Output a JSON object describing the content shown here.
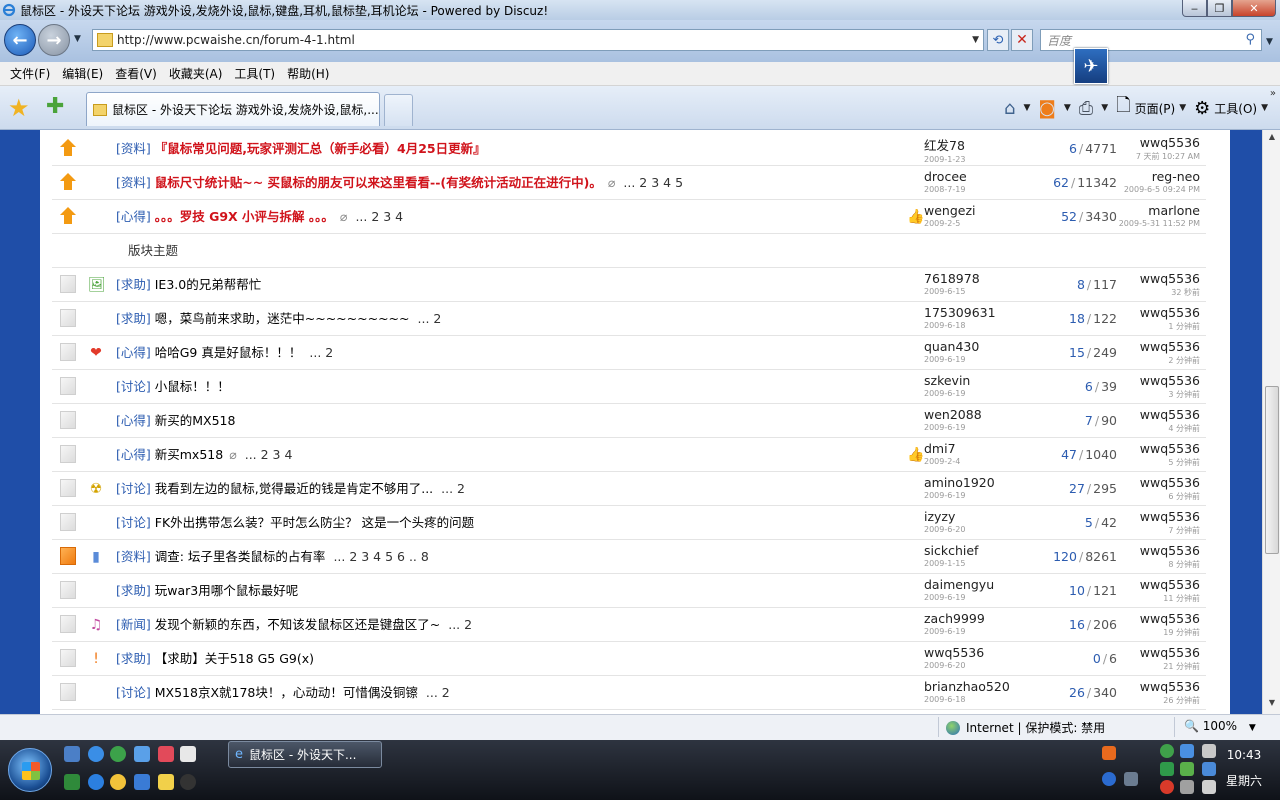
{
  "window": {
    "title": "鼠标区 - 外设天下论坛 游戏外设,发烧外设,鼠标,键盘,耳机,鼠标垫,耳机论坛 - Powered by Discuz!",
    "minimize": "‒",
    "maximize": "❐",
    "close": "✕"
  },
  "address": {
    "url": "http://www.pcwaishe.cn/forum-4-1.html",
    "search_placeholder": "百度"
  },
  "menu": [
    "文件(F)",
    "编辑(E)",
    "查看(V)",
    "收藏夹(A)",
    "工具(T)",
    "帮助(H)"
  ],
  "tab": {
    "title": "鼠标区 - 外设天下论坛 游戏外设,发烧外设,鼠标,..."
  },
  "commands": {
    "page": "页面(P)",
    "tools": "工具(O)"
  },
  "forum": {
    "section_label": "版块主题",
    "threads": [
      {
        "folder": "up",
        "cat": "[资料]",
        "title": "『鼠标常见问题,玩家评测汇总（新手必看）4月25日更新』",
        "red": true,
        "clip": false,
        "pages": "",
        "icon": "",
        "thumb": false,
        "author": "红发78",
        "date": "2009-1-23",
        "replies": "6",
        "views": "4771",
        "last_user": "wwq5536",
        "last_time": "7 天前 10:27 AM"
      },
      {
        "folder": "up",
        "cat": "[资料]",
        "title": "鼠标尺寸统计贴~~ 买鼠标的朋友可以来这里看看--(有奖统计活动正在进行中)。",
        "red": true,
        "clip": true,
        "pages": "... 2 3 4 5",
        "icon": "",
        "thumb": false,
        "author": "drocee",
        "date": "2008-7-19",
        "replies": "62",
        "views": "11342",
        "last_user": "reg-neo",
        "last_time": "2009-6-5 09:24 PM"
      },
      {
        "folder": "up",
        "cat": "[心得]",
        "title": "。。。罗技 G9X 小评与拆解 。。。",
        "red": true,
        "clip": true,
        "pages": "... 2 3 4",
        "icon": "",
        "thumb": true,
        "author": "wengezi",
        "date": "2009-2-5",
        "replies": "52",
        "views": "3430",
        "last_user": "marlone",
        "last_time": "2009-5-31 11:52 PM"
      },
      {
        "section": true
      },
      {
        "folder": "doc",
        "cat": "[求助]",
        "title": "IE3.0的兄弟帮帮忙",
        "red": false,
        "clip": false,
        "pages": "",
        "icon": "img",
        "thumb": false,
        "author": "7618978",
        "date": "2009-6-15",
        "replies": "8",
        "views": "117",
        "last_user": "wwq5536",
        "last_time": "32 秒前"
      },
      {
        "folder": "doc",
        "cat": "[求助]",
        "title": "嗯，菜鸟前来求助，迷茫中~~~~~~~~~~",
        "red": false,
        "clip": false,
        "pages": "... 2",
        "icon": "",
        "thumb": false,
        "author": "175309631",
        "date": "2009-6-18",
        "replies": "18",
        "views": "122",
        "last_user": "wwq5536",
        "last_time": "1 分钟前"
      },
      {
        "folder": "doc",
        "cat": "[心得]",
        "title": "哈哈G9 真是好鼠标！！！",
        "red": false,
        "clip": false,
        "pages": "... 2",
        "icon": "heart",
        "thumb": false,
        "author": "quan430",
        "date": "2009-6-19",
        "replies": "15",
        "views": "249",
        "last_user": "wwq5536",
        "last_time": "2 分钟前"
      },
      {
        "folder": "doc",
        "cat": "[讨论]",
        "title": "小鼠标！！！",
        "red": false,
        "clip": false,
        "pages": "",
        "icon": "",
        "thumb": false,
        "author": "szkevin",
        "date": "2009-6-19",
        "replies": "6",
        "views": "39",
        "last_user": "wwq5536",
        "last_time": "3 分钟前"
      },
      {
        "folder": "doc",
        "cat": "[心得]",
        "title": "新买的MX518",
        "red": false,
        "clip": false,
        "pages": "",
        "icon": "",
        "thumb": false,
        "author": "wen2088",
        "date": "2009-6-19",
        "replies": "7",
        "views": "90",
        "last_user": "wwq5536",
        "last_time": "4 分钟前"
      },
      {
        "folder": "doc",
        "cat": "[心得]",
        "title": "新买mx518",
        "red": false,
        "clip": true,
        "pages": "... 2 3 4",
        "icon": "",
        "thumb": true,
        "author": "dmi7",
        "date": "2009-2-4",
        "replies": "47",
        "views": "1040",
        "last_user": "wwq5536",
        "last_time": "5 分钟前"
      },
      {
        "folder": "doc",
        "cat": "[讨论]",
        "title": "我看到左边的鼠标,觉得最近的钱是肯定不够用了...",
        "red": false,
        "clip": false,
        "pages": "... 2",
        "icon": "radiation",
        "thumb": false,
        "author": "amino1920",
        "date": "2009-6-19",
        "replies": "27",
        "views": "295",
        "last_user": "wwq5536",
        "last_time": "6 分钟前"
      },
      {
        "folder": "doc",
        "cat": "[讨论]",
        "title": "FK外出携带怎么装？平时怎么防尘？ 这是一个头疼的问题",
        "red": false,
        "clip": false,
        "pages": "",
        "icon": "",
        "thumb": false,
        "author": "izyzy",
        "date": "2009-6-20",
        "replies": "5",
        "views": "42",
        "last_user": "wwq5536",
        "last_time": "7 分钟前"
      },
      {
        "folder": "hot",
        "cat": "[资料]",
        "title": "调查: 坛子里各类鼠标的占有率",
        "red": false,
        "clip": false,
        "pages": "... 2 3 4 5 6 .. 8",
        "icon": "chart",
        "thumb": false,
        "author": "sickchief",
        "date": "2009-1-15",
        "replies": "120",
        "views": "8261",
        "last_user": "wwq5536",
        "last_time": "8 分钟前"
      },
      {
        "folder": "doc",
        "cat": "[求助]",
        "title": "玩war3用哪个鼠标最好呢",
        "red": false,
        "clip": false,
        "pages": "",
        "icon": "",
        "thumb": false,
        "author": "daimengyu",
        "date": "2009-6-19",
        "replies": "10",
        "views": "121",
        "last_user": "wwq5536",
        "last_time": "11 分钟前"
      },
      {
        "folder": "doc",
        "cat": "[新闻]",
        "title": "发现个新颖的东西，不知该发鼠标区还是键盘区了~",
        "red": false,
        "clip": false,
        "pages": "... 2",
        "icon": "music",
        "thumb": false,
        "author": "zach9999",
        "date": "2009-6-19",
        "replies": "16",
        "views": "206",
        "last_user": "wwq5536",
        "last_time": "19 分钟前"
      },
      {
        "folder": "doc",
        "cat": "[求助]",
        "title": "【求助】关于518 G5 G9(x)",
        "red": false,
        "clip": false,
        "pages": "",
        "icon": "alert",
        "thumb": false,
        "author": "wwq5536",
        "date": "2009-6-20",
        "replies": "0",
        "views": "6",
        "last_user": "wwq5536",
        "last_time": "21 分钟前"
      },
      {
        "folder": "doc",
        "cat": "[讨论]",
        "title": "MX518京X就178块！，心动动！可惜偶没铜镲",
        "red": false,
        "clip": false,
        "pages": "... 2",
        "icon": "",
        "thumb": false,
        "author": "brianzhao520",
        "date": "2009-6-18",
        "replies": "26",
        "views": "340",
        "last_user": "wwq5536",
        "last_time": "26 分钟前"
      }
    ]
  },
  "status": {
    "zone": "Internet | 保护模式: 禁用",
    "zoom": "100%"
  },
  "taskbar": {
    "window_item": "鼠标区 - 外设天下...",
    "time": "10:43",
    "day": "星期六"
  }
}
